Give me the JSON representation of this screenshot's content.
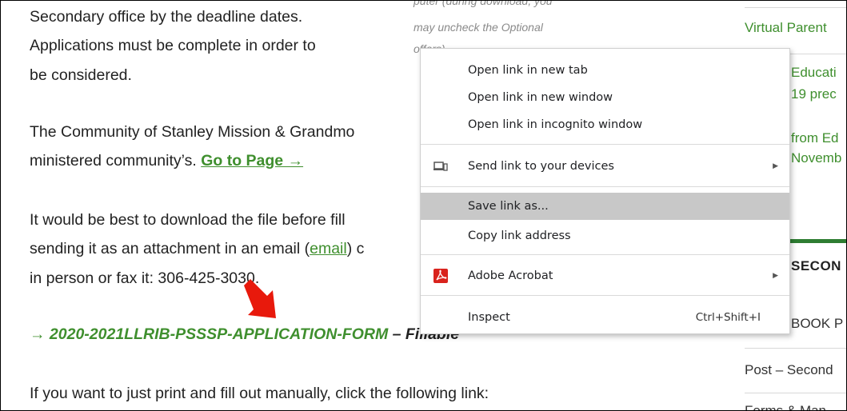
{
  "article": {
    "p1_line1": "Secondary office by the deadline dates.",
    "p1_line2": "Applications must be complete in order to",
    "p1_line3": "be considered.",
    "p2_line1": "The Community of Stanley Mission & Grandmo",
    "p2_line2": "ministered community’s.",
    "p2_link": "Go to Page →",
    "p3_line1": "It would be best to download the file before fill",
    "p3_line2a": "sending it as an attachment in an email (",
    "p3_line2_link": "email",
    "p3_line2b": ") c",
    "p3_line3": "in person or fax it: 306-425-3030.",
    "file_prefix": "→ 2020-2021LLRIB-PSSSP-APPLICATION-FORM",
    "file_suffix": " – Fillable",
    "p4_line1": "If you want to just print and fill out manually, click the following link:"
  },
  "faded_note": {
    "line1": "puter (during download, you",
    "line2": "may uncheck the Optional",
    "line3": "offers)"
  },
  "sidebar": {
    "item1": "Virtual Parent",
    "item2a": "Educati",
    "item2b": "19 prec",
    "item3a": "from Ed",
    "item3b": "Novemb",
    "heading": "SECON",
    "item4": "BOOK P",
    "item5": "Post – Second",
    "item6": "Forms & Man"
  },
  "context_menu": {
    "items": [
      {
        "label": "Open link in new tab"
      },
      {
        "label": "Open link in new window"
      },
      {
        "label": "Open link in incognito window"
      },
      {
        "label": "Send link to your devices",
        "icon": "devices-icon",
        "submenu": true
      },
      {
        "label": "Save link as...",
        "highlighted": true
      },
      {
        "label": "Copy link address"
      },
      {
        "label": "Adobe Acrobat",
        "icon": "adobe-acrobat-icon",
        "submenu": true
      },
      {
        "label": "Inspect",
        "shortcut": "Ctrl+Shift+I"
      }
    ]
  },
  "colors": {
    "link_green": "#3f8f2e",
    "sidebar_bar": "#2e7d32",
    "menu_highlight": "#c8c8c8",
    "annotation_arrow": "#e8190c",
    "acrobat_red": "#d9231d"
  }
}
